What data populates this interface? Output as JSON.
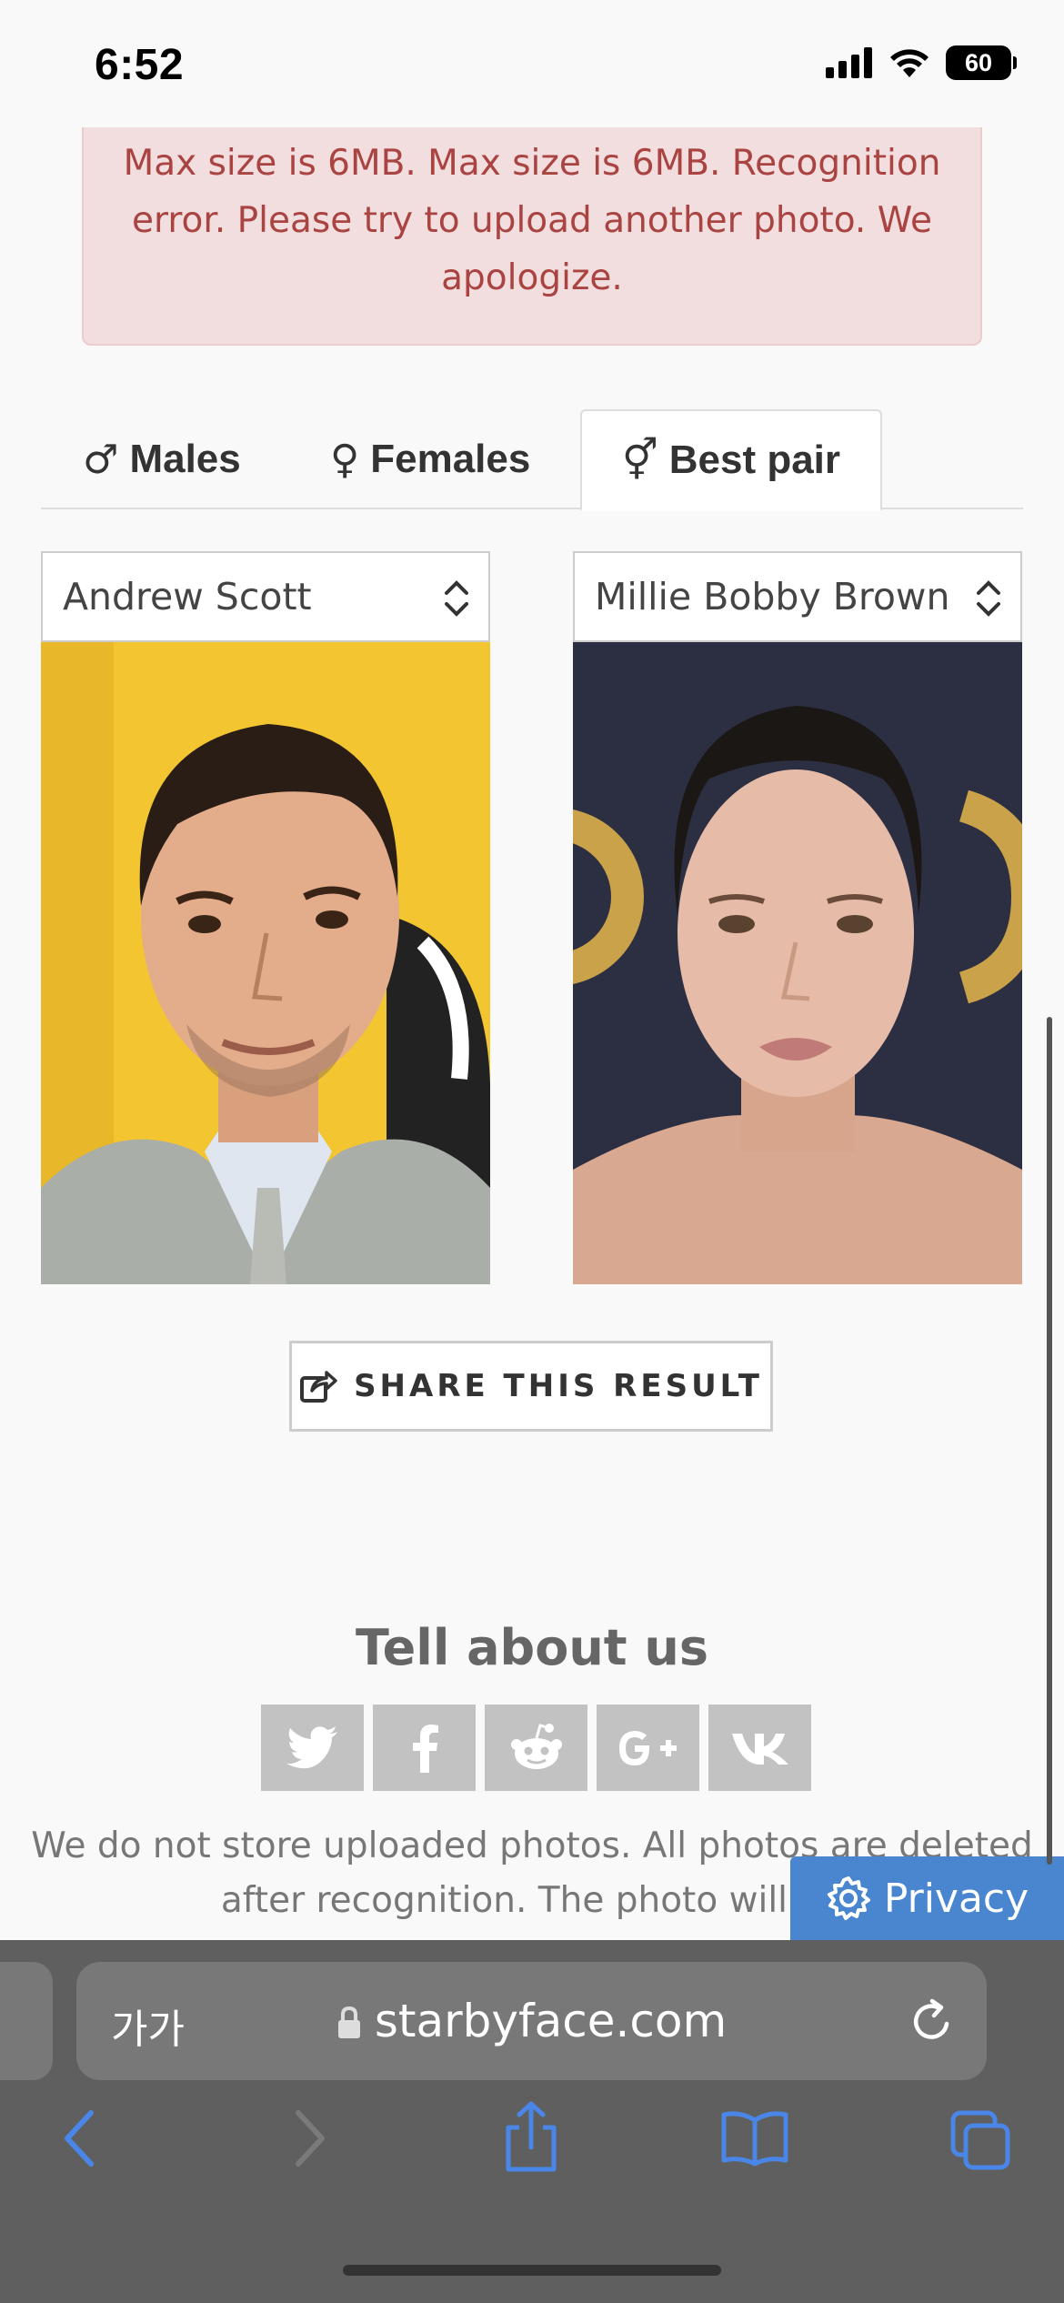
{
  "status_bar": {
    "time": "6:52",
    "battery": "60"
  },
  "alert": {
    "text": "Max size is 6MB. Max size is 6MB. Recognition error. Please try to upload another photo. We apologize."
  },
  "tabs": [
    {
      "symbol": "♂",
      "label": "Males",
      "active": false
    },
    {
      "symbol": "♀",
      "label": "Females",
      "active": false
    },
    {
      "symbol": "⚥",
      "label": "Best pair",
      "active": true
    }
  ],
  "pair": {
    "left": {
      "selected": "Andrew Scott"
    },
    "right": {
      "selected": "Millie Bobby Brown"
    }
  },
  "share": {
    "label": "SHARE THIS RESULT"
  },
  "social": {
    "title": "Tell about us",
    "buttons": [
      "twitter",
      "facebook",
      "reddit",
      "google-plus",
      "vk"
    ],
    "note": "We do not store uploaded photos. All photos are deleted after recognition. The photo will be"
  },
  "privacy": {
    "label": "Privacy"
  },
  "browser": {
    "text_size": "가가",
    "url": "starbyface.com"
  },
  "colors": {
    "alert_bg": "#f2dede",
    "alert_text": "#a94442",
    "privacy": "#4a86d0",
    "ios_blue": "#4a86e8"
  }
}
